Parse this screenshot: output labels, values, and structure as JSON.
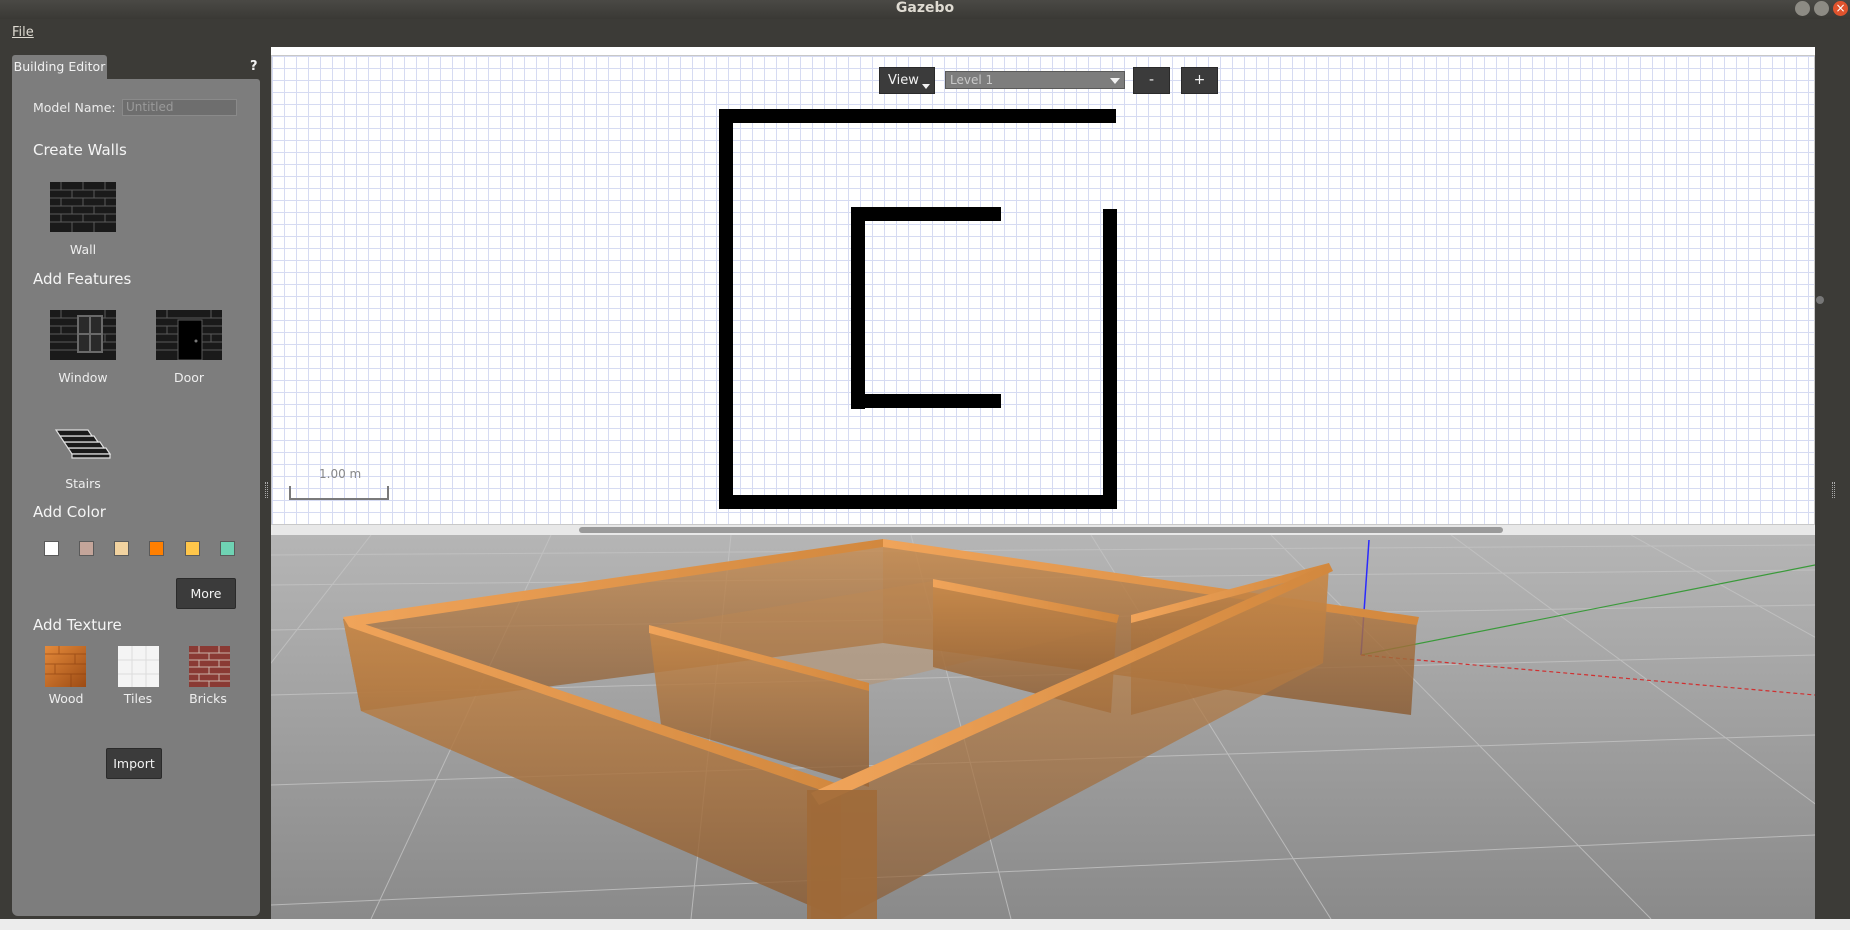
{
  "window": {
    "title": "Gazebo"
  },
  "menubar": {
    "file": "File"
  },
  "panel": {
    "tab": "Building Editor",
    "help": "?",
    "model_name_label": "Model Name:",
    "model_name_value": "Untitled",
    "create_walls": "Create Walls",
    "wall": "Wall",
    "add_features": "Add Features",
    "window": "Window",
    "door": "Door",
    "stairs": "Stairs",
    "add_color": "Add Color",
    "colors": [
      "#ffffff",
      "#c4a59a",
      "#f2d3a0",
      "#ff7f00",
      "#ffc64a",
      "#6fd3b4"
    ],
    "more": "More",
    "add_texture": "Add Texture",
    "wood": "Wood",
    "tiles": "Tiles",
    "bricks": "Bricks",
    "import": "Import"
  },
  "editor": {
    "view": "View",
    "level": "Level 1",
    "zoom_out": "-",
    "zoom_in": "+",
    "scale": "1.00 m"
  }
}
